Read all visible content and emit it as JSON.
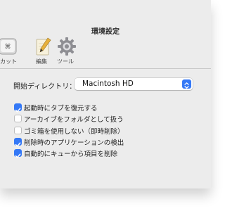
{
  "window": {
    "title": "環境設定"
  },
  "toolbar": {
    "items": [
      {
        "label": "ートカット",
        "icon": "shortcut-icon"
      },
      {
        "label": "編集",
        "icon": "edit-icon"
      },
      {
        "label": "ツール",
        "icon": "gear-icon"
      }
    ]
  },
  "settings": {
    "start_dir_label": "開始ディレクトリ：",
    "start_dir_value": "Macintosh HD",
    "options": [
      {
        "label": "起動時にタブを復元する",
        "checked": true
      },
      {
        "label": "アーカイブをフォルダとして扱う",
        "checked": false
      },
      {
        "label": "ゴミ箱を使用しない（即時削除）",
        "checked": false
      },
      {
        "label": "削除時のアプリケーションの検出",
        "checked": true
      },
      {
        "label": "自動的にキューから項目を削除",
        "checked": true
      }
    ]
  },
  "colors": {
    "accent": "#3478f6",
    "window_bg": "#ececec"
  }
}
